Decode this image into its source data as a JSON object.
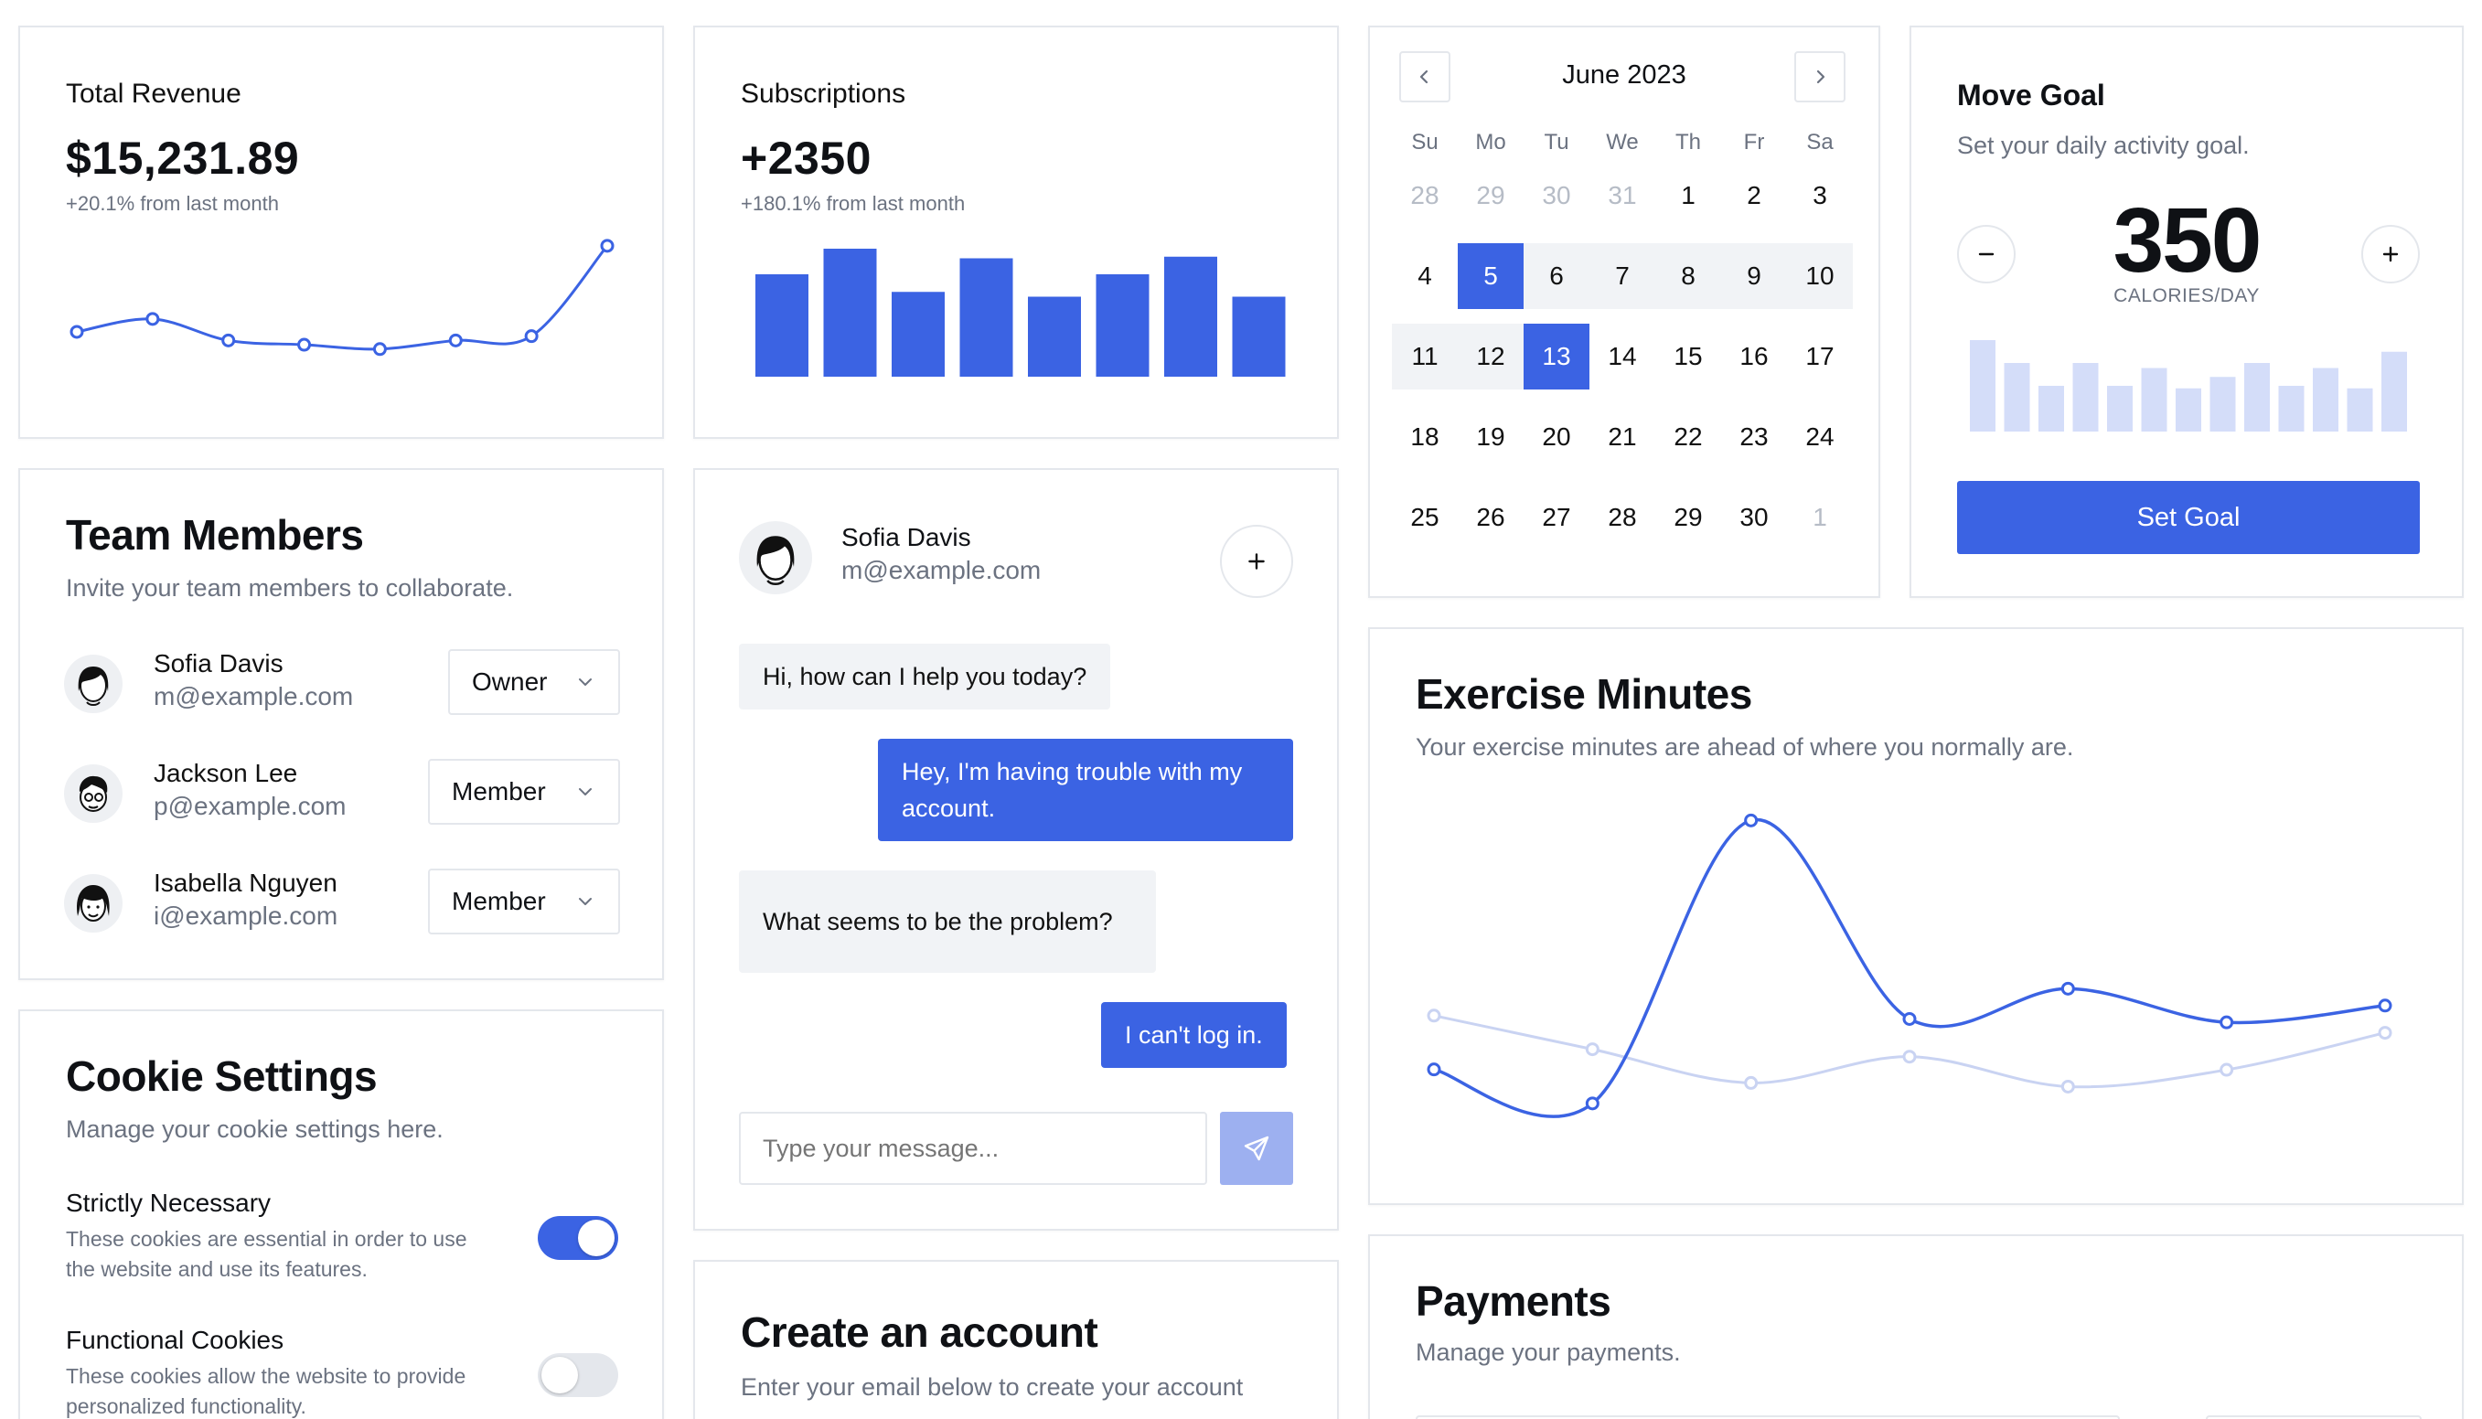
{
  "revenue": {
    "title": "Total Revenue",
    "value": "$15,231.89",
    "change": "+20.1% from last month",
    "chart_data": {
      "type": "line",
      "x": [
        1,
        2,
        3,
        4,
        5,
        6,
        7,
        8
      ],
      "values": [
        10,
        13,
        8,
        7,
        6,
        8,
        9,
        30
      ],
      "ylim": [
        0,
        34
      ]
    }
  },
  "subscriptions": {
    "title": "Subscriptions",
    "value": "+2350",
    "change": "+180.1% from last month",
    "chart_data": {
      "type": "bar",
      "categories": [
        "1",
        "2",
        "3",
        "4",
        "5",
        "6",
        "7",
        "8"
      ],
      "values": [
        64,
        80,
        53,
        74,
        50,
        64,
        75,
        50
      ],
      "ylim": [
        0,
        80
      ]
    }
  },
  "calendar": {
    "month": "June 2023",
    "weekdays": [
      "Su",
      "Mo",
      "Tu",
      "We",
      "Th",
      "Fr",
      "Sa"
    ],
    "days": [
      [
        "28",
        "29",
        "30",
        "31",
        "1",
        "2",
        "3"
      ],
      [
        "4",
        "5",
        "6",
        "7",
        "8",
        "9",
        "10"
      ],
      [
        "11",
        "12",
        "13",
        "14",
        "15",
        "16",
        "17"
      ],
      [
        "18",
        "19",
        "20",
        "21",
        "22",
        "23",
        "24"
      ],
      [
        "25",
        "26",
        "27",
        "28",
        "29",
        "30",
        "1"
      ]
    ],
    "outside_days": [
      [
        0,
        0
      ],
      [
        0,
        1
      ],
      [
        0,
        2
      ],
      [
        0,
        3
      ],
      [
        4,
        6
      ]
    ],
    "range_start": [
      1,
      1
    ],
    "range_end": [
      2,
      2
    ],
    "range_cells": [
      [
        1,
        1
      ],
      [
        1,
        2
      ],
      [
        1,
        3
      ],
      [
        1,
        4
      ],
      [
        1,
        5
      ],
      [
        1,
        6
      ],
      [
        2,
        0
      ],
      [
        2,
        1
      ],
      [
        2,
        2
      ]
    ],
    "prev_icon": "chevron-left-icon",
    "next_icon": "chevron-right-icon"
  },
  "move_goal": {
    "title": "Move Goal",
    "subtitle": "Set your daily activity goal.",
    "value": "350",
    "unit": "CALORIES/DAY",
    "button": "Set Goal",
    "accent": "#3b63e3",
    "chart_data": {
      "type": "bar",
      "categories": [
        "1",
        "2",
        "3",
        "4",
        "5",
        "6",
        "7",
        "8",
        "9",
        "10",
        "11",
        "12",
        "13"
      ],
      "values": [
        400,
        300,
        200,
        300,
        200,
        278,
        189,
        239,
        300,
        200,
        278,
        189,
        349
      ],
      "ylim": [
        0,
        400
      ]
    }
  },
  "team": {
    "title": "Team Members",
    "subtitle": "Invite your team members to collaborate.",
    "members": [
      {
        "name": "Sofia Davis",
        "email": "m@example.com",
        "role": "Owner"
      },
      {
        "name": "Jackson Lee",
        "email": "p@example.com",
        "role": "Member"
      },
      {
        "name": "Isabella Nguyen",
        "email": "i@example.com",
        "role": "Member"
      }
    ]
  },
  "chat": {
    "user_name": "Sofia Davis",
    "user_email": "m@example.com",
    "messages": [
      {
        "from": "agent",
        "text": "Hi, how can I help you today?"
      },
      {
        "from": "user",
        "text": "Hey, I'm having trouble with my account."
      },
      {
        "from": "agent",
        "text": "What seems to be the problem?"
      },
      {
        "from": "user",
        "text": "I can't log in."
      }
    ],
    "input_placeholder": "Type your message...",
    "send_icon": "send-icon",
    "add_icon": "plus-icon"
  },
  "exercise": {
    "title": "Exercise Minutes",
    "subtitle": "Your exercise minutes are ahead of where you normally are.",
    "chart_data": {
      "type": "line",
      "x": [
        1,
        2,
        3,
        4,
        5,
        6,
        7
      ],
      "series": [
        {
          "values": [
            240,
            139,
            980,
            390,
            480,
            380,
            430
          ]
        },
        {
          "values": [
            400,
            300,
            200,
            278,
            189,
            239,
            349
          ]
        }
      ],
      "ylim": [
        0,
        1000
      ],
      "colors": [
        "#3b63e3",
        "#c9d3f2"
      ]
    }
  },
  "cookies": {
    "title": "Cookie Settings",
    "subtitle": "Manage your cookie settings here.",
    "items": [
      {
        "title": "Strictly Necessary",
        "desc_line1": "These cookies are essential in order to use",
        "desc_line2": "the website and use its features.",
        "enabled": true
      },
      {
        "title": "Functional Cookies",
        "desc_line1": "These cookies allow the website to provide",
        "desc_line2": "personalized functionality.",
        "enabled": false
      }
    ]
  },
  "account": {
    "title": "Create an account",
    "subtitle": "Enter your email below to create your account"
  },
  "payments": {
    "title": "Payments",
    "subtitle": "Manage your payments."
  }
}
